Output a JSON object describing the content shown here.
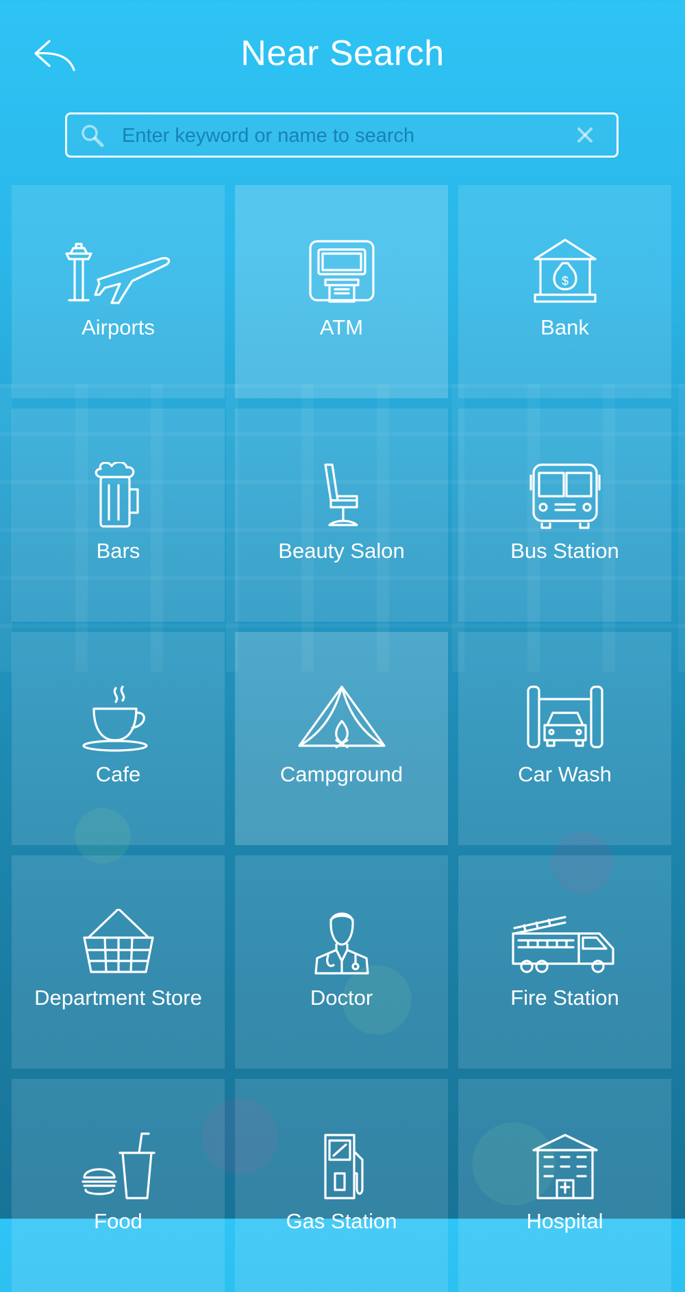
{
  "header": {
    "title": "Near Search",
    "back_icon": "back-arrow-icon"
  },
  "search": {
    "placeholder": "Enter keyword or name to search",
    "value": "",
    "search_icon": "search-icon",
    "clear_icon": "close-icon"
  },
  "categories": [
    {
      "label": "Airports",
      "icon": "airport-icon"
    },
    {
      "label": "ATM",
      "icon": "atm-icon"
    },
    {
      "label": "Bank",
      "icon": "bank-icon"
    },
    {
      "label": "Bars",
      "icon": "beer-icon"
    },
    {
      "label": "Beauty Salon",
      "icon": "salon-chair-icon"
    },
    {
      "label": "Bus Station",
      "icon": "bus-icon"
    },
    {
      "label": "Cafe",
      "icon": "coffee-cup-icon"
    },
    {
      "label": "Campground",
      "icon": "tent-icon"
    },
    {
      "label": "Car Wash",
      "icon": "car-wash-icon"
    },
    {
      "label": "Department Store",
      "icon": "basket-icon"
    },
    {
      "label": "Doctor",
      "icon": "doctor-icon"
    },
    {
      "label": "Fire Station",
      "icon": "fire-truck-icon"
    },
    {
      "label": "Food",
      "icon": "burger-drink-icon"
    },
    {
      "label": "Gas Station",
      "icon": "fuel-pump-icon"
    },
    {
      "label": "Hospital",
      "icon": "hospital-icon"
    }
  ],
  "colors": {
    "background_top": "#2ec4f5",
    "background_bottom": "#187398",
    "text": "#ffffff",
    "placeholder": "#1a7aa8"
  }
}
